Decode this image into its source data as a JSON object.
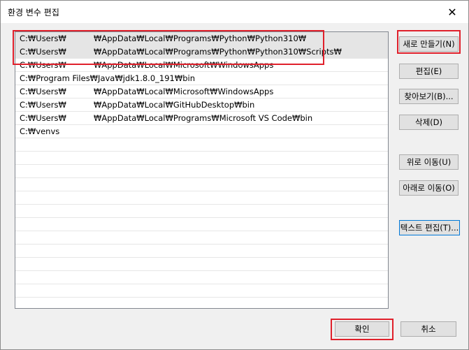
{
  "window": {
    "title": "환경 변수 편집",
    "close_glyph": "✕"
  },
  "paths": [
    {
      "prefix": "C:₩Users₩",
      "suffix": "₩AppData₩Local₩Programs₩Python₩Python310₩",
      "selected": true
    },
    {
      "prefix": "C:₩Users₩",
      "suffix": "₩AppData₩Local₩Programs₩Python₩Python310₩Scripts₩",
      "selected": true
    },
    {
      "prefix": "C:₩Users₩",
      "suffix": "₩AppData₩Local₩Microsoft₩WindowsApps",
      "selected": false
    },
    {
      "prefix": "C:₩Program Files₩Java₩jdk1.8.0_191₩bin",
      "suffix": "",
      "selected": false
    },
    {
      "prefix": "C:₩Users₩",
      "suffix": "₩AppData₩Local₩Microsoft₩WindowsApps",
      "selected": false
    },
    {
      "prefix": "C:₩Users₩",
      "suffix": "₩AppData₩Local₩GitHubDesktop₩bin",
      "selected": false
    },
    {
      "prefix": "C:₩Users₩",
      "suffix": "₩AppData₩Local₩Programs₩Microsoft VS Code₩bin",
      "selected": false
    },
    {
      "prefix": "C:₩venvs",
      "suffix": "",
      "selected": false
    }
  ],
  "buttons": {
    "new": "새로 만들기(N)",
    "edit": "편집(E)",
    "browse": "찾아보기(B)...",
    "delete": "삭제(D)",
    "move_up": "위로 이동(U)",
    "move_down": "아래로 이동(O)",
    "edit_text": "텍스트 편집(T)...",
    "ok": "확인",
    "cancel": "취소"
  },
  "colors": {
    "highlight": "#e0202b",
    "focus": "#0078d7"
  }
}
